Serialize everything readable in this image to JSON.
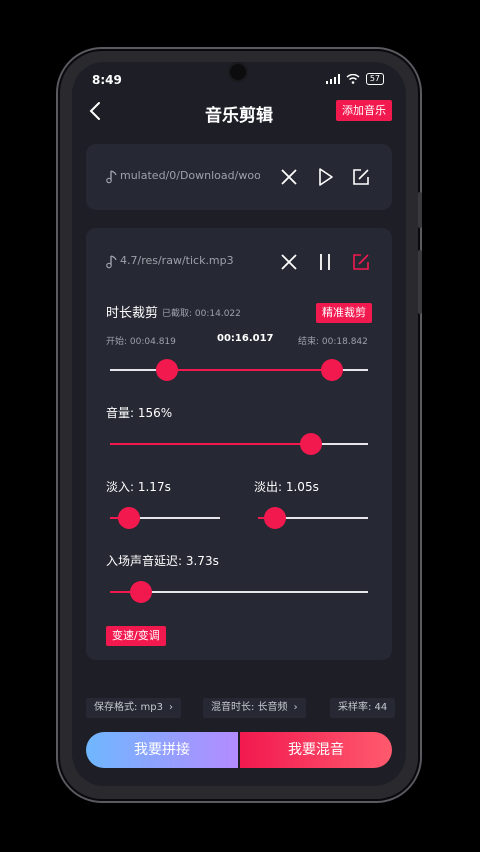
{
  "status_bar": {
    "time": "8:49",
    "battery": "57"
  },
  "header": {
    "title": "音乐剪辑",
    "add_button": "添加音乐"
  },
  "track1": {
    "path": "mulated/0/Download/wood"
  },
  "track2": {
    "path": "4.7/res/raw/tick.mp3"
  },
  "trim": {
    "label": "时长裁剪",
    "cut_info": "已截取: 00:14.022",
    "precise_button": "精准裁剪",
    "start": "开始: 00:04.819",
    "current": "00:16.017",
    "end": "结束: 00:18.842",
    "range_start_fraction": 0.22,
    "range_end_fraction": 0.86
  },
  "volume": {
    "label": "音量: 156%",
    "fraction": 0.78
  },
  "fade_in": {
    "label": "淡入: 1.17s",
    "fraction": 0.17
  },
  "fade_out": {
    "label": "淡出: 1.05s",
    "fraction": 0.15
  },
  "delay": {
    "label": "入场声音延迟: 3.73s",
    "fraction": 0.12
  },
  "speed_button": "变速/变调",
  "chips": [
    {
      "label": "保存格式: mp3"
    },
    {
      "label": "混音时长: 长音频"
    },
    {
      "label": "采样率: 44"
    }
  ],
  "bottom": {
    "splice": "我要拼接",
    "mix": "我要混音"
  },
  "colors": {
    "accent": "#f2194f",
    "card": "#262833",
    "background": "#1d1e26"
  }
}
